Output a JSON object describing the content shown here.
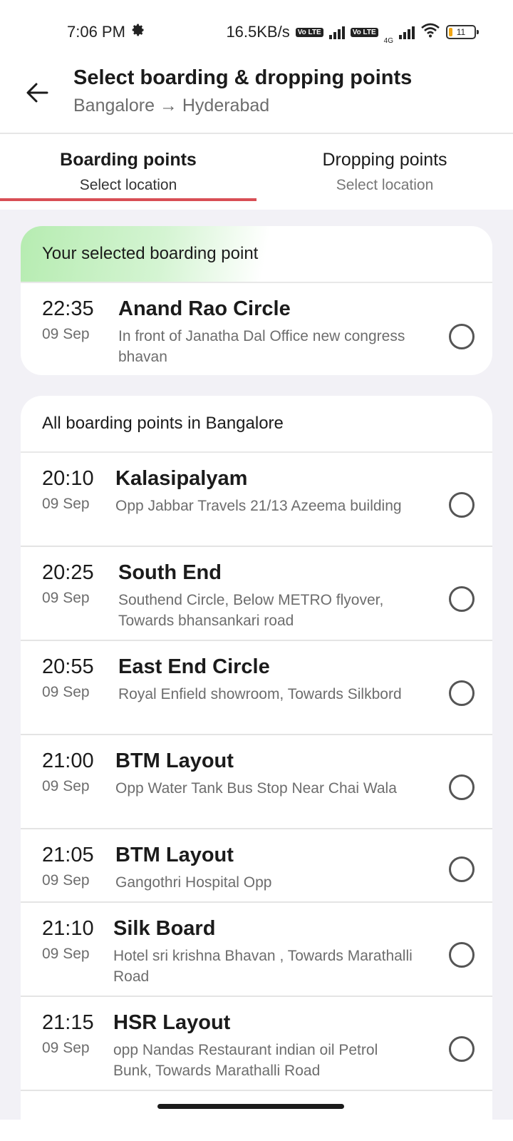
{
  "status_bar": {
    "time": "7:06 PM",
    "network_speed": "16.5KB/s",
    "volte1": "Vo LTE",
    "volte2": "Vo LTE",
    "network_type": "4G",
    "battery": "11"
  },
  "header": {
    "title": "Select boarding & dropping points",
    "route": "Bangalore → Hyderabad"
  },
  "tabs": [
    {
      "label": "Boarding points",
      "sub": "Select location"
    },
    {
      "label": "Dropping points",
      "sub": "Select location"
    }
  ],
  "selected_card": {
    "heading": "Your selected boarding point",
    "point": {
      "time": "22:35",
      "date": "09 Sep",
      "name": "Anand Rao Circle",
      "address": "In front of Janatha Dal Office new congress bhavan"
    }
  },
  "all_card": {
    "heading": "All boarding points in Bangalore",
    "points": [
      {
        "time": "20:10",
        "date": "09 Sep",
        "name": "Kalasipalyam",
        "address": "Opp Jabbar Travels  21/13 Azeema building"
      },
      {
        "time": "20:25",
        "date": "09 Sep",
        "name": "South End",
        "address": "Southend Circle, Below METRO flyover, Towards bhansankari road"
      },
      {
        "time": "20:55",
        "date": "09 Sep",
        "name": "East End Circle",
        "address": "Royal Enfield showroom, Towards Silkbord"
      },
      {
        "time": "21:00",
        "date": "09 Sep",
        "name": "BTM Layout",
        "address": "Opp Water Tank Bus Stop Near Chai Wala"
      },
      {
        "time": "21:05",
        "date": "09 Sep",
        "name": "BTM Layout",
        "address": "Gangothri Hospital Opp"
      },
      {
        "time": "21:10",
        "date": "09 Sep",
        "name": "Silk Board",
        "address": "Hotel sri krishna Bhavan ,  Towards Marathalli Road"
      },
      {
        "time": "21:15",
        "date": "09 Sep",
        "name": "HSR Layout",
        "address": "opp Nandas Restaurant indian oil Petrol Bunk, Towards Marathalli Road"
      }
    ]
  },
  "colors": {
    "accent": "#d84e55",
    "selected_gradient": "#b6ecb1",
    "background": "#f2f1f6"
  }
}
